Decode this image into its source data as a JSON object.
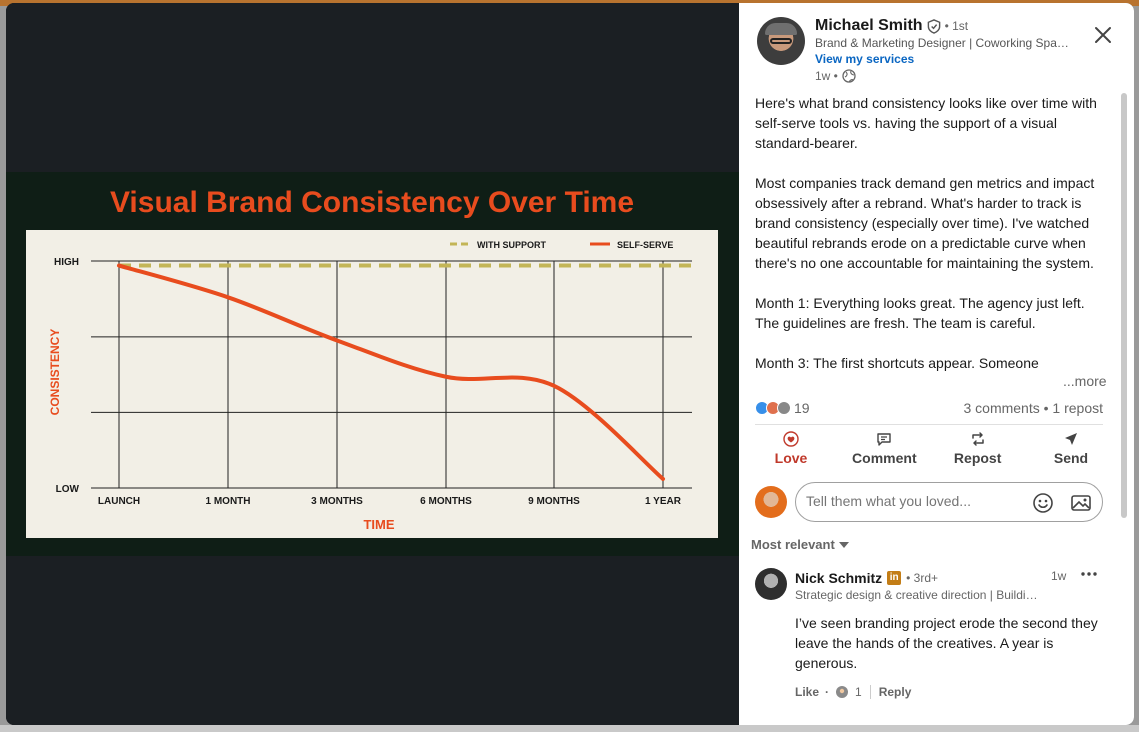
{
  "post": {
    "author": {
      "name": "Michael Smith",
      "degree": "• 1st",
      "headline": "Brand & Marketing Designer | Coworking Space Owner",
      "services_link": "View my services",
      "time": "1w •"
    },
    "text": {
      "p1": "Here's what brand consistency looks like over time with self-serve tools vs. having the support of a visual standard-bearer.",
      "p2": "Most companies track demand gen metrics and impact obsessively after a rebrand. What's harder to track is brand consistency (especially over time). I've watched beautiful rebrands erode on a predictable curve when there's no one accountable for maintaining the system.",
      "p3": "Month 1: Everything looks great. The agency just left. The guidelines are fresh. The team is careful.",
      "p4": "Month 3: The first shortcuts appear. Someone"
    },
    "more_label": "...more",
    "reaction_count": "19",
    "comments_reposts": "3 comments • 1 repost",
    "actions": {
      "love": "Love",
      "comment": "Comment",
      "repost": "Repost",
      "send": "Send"
    }
  },
  "composer": {
    "placeholder": "Tell them what you loved..."
  },
  "sort": {
    "label": "Most relevant"
  },
  "comment": {
    "name": "Nick Schmitz",
    "badge": "in",
    "degree": "• 3rd+",
    "time": "1w",
    "headline": "Strategic design & creative direction | Building brands",
    "text": "I’ve seen branding project erode the second they leave the hands of the creatives. A year is generous.",
    "like_label": "Like",
    "like_count": "1",
    "reply_label": "Reply"
  },
  "colors": {
    "chart_bg": "#f2efe6",
    "chart_frame": "#0f1e16",
    "title_orange": "#e84c1e",
    "self_serve": "#e84c1e",
    "with_support": "#c3b556",
    "link_blue": "#0a66c2",
    "love_red": "#c0392b"
  },
  "chart_data": {
    "type": "line",
    "title": "Visual Brand Consistency Over Time",
    "xlabel": "TIME",
    "ylabel": "CONSISTENCY",
    "categories": [
      "LAUNCH",
      "1 MONTH",
      "3 MONTHS",
      "6 MONTHS",
      "9 MONTHS",
      "1 YEAR"
    ],
    "y_tick_labels": [
      "HIGH",
      "LOW"
    ],
    "ylim": [
      0,
      100
    ],
    "grid": true,
    "legend_position": "top-right",
    "series": [
      {
        "name": "WITH SUPPORT",
        "style": "dashed",
        "color": "#c3b556",
        "values": [
          98,
          98,
          98,
          98,
          98,
          98
        ]
      },
      {
        "name": "SELF-SERVE",
        "style": "solid",
        "color": "#e84c1e",
        "values": [
          98,
          84,
          65,
          49,
          45,
          4
        ]
      }
    ]
  }
}
